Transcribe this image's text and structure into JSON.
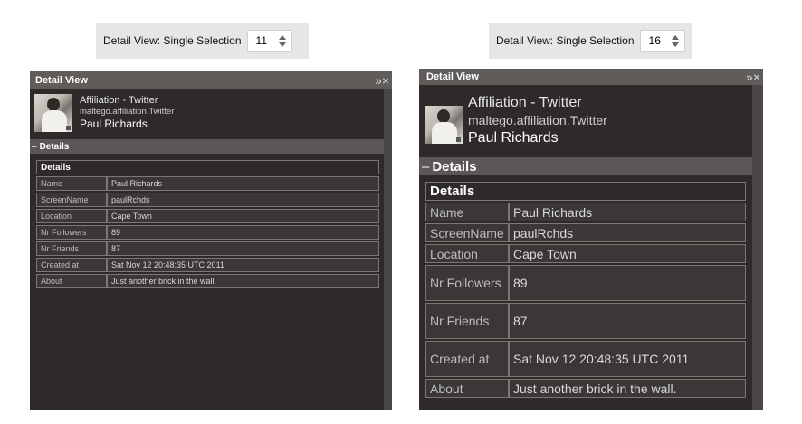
{
  "panels": [
    {
      "control_label": "Detail View: Single Selection",
      "font_size_value": "11",
      "title": "Detail View",
      "title_buttons": "»×",
      "entity_type": "Affiliation - Twitter",
      "entity_id": "maltego.affiliation.Twitter",
      "entity_name": "Paul Richards",
      "section_label": "Details",
      "table_header": "Details",
      "rows": [
        {
          "k": "Name",
          "v": "Paul Richards"
        },
        {
          "k": "ScreenName",
          "v": "paulRchds"
        },
        {
          "k": "Location",
          "v": "Cape Town"
        },
        {
          "k": "Nr Followers",
          "v": "89"
        },
        {
          "k": "Nr Friends",
          "v": "87"
        },
        {
          "k": "Created at",
          "v": "Sat Nov 12 20:48:35 UTC 2011"
        },
        {
          "k": "About",
          "v": "Just another brick in the wall."
        }
      ]
    },
    {
      "control_label": "Detail View: Single Selection",
      "font_size_value": "16",
      "title": "Detail View",
      "title_buttons": "»×",
      "entity_type": "Affiliation - Twitter",
      "entity_id": "maltego.affiliation.Twitter",
      "entity_name": "Paul Richards",
      "section_label": "Details",
      "table_header": "Details",
      "rows": [
        {
          "k": "Name",
          "v": "Paul Richards"
        },
        {
          "k": "ScreenName",
          "v": "paulRchds"
        },
        {
          "k": "Location",
          "v": "Cape Town"
        },
        {
          "k": "Nr Followers",
          "v": "89"
        },
        {
          "k": "Nr Friends",
          "v": "87"
        },
        {
          "k": "Created at",
          "v": "Sat Nov 12 20:48:35 UTC 2011"
        },
        {
          "k": "About",
          "v": "Just another brick in the wall."
        }
      ]
    }
  ]
}
